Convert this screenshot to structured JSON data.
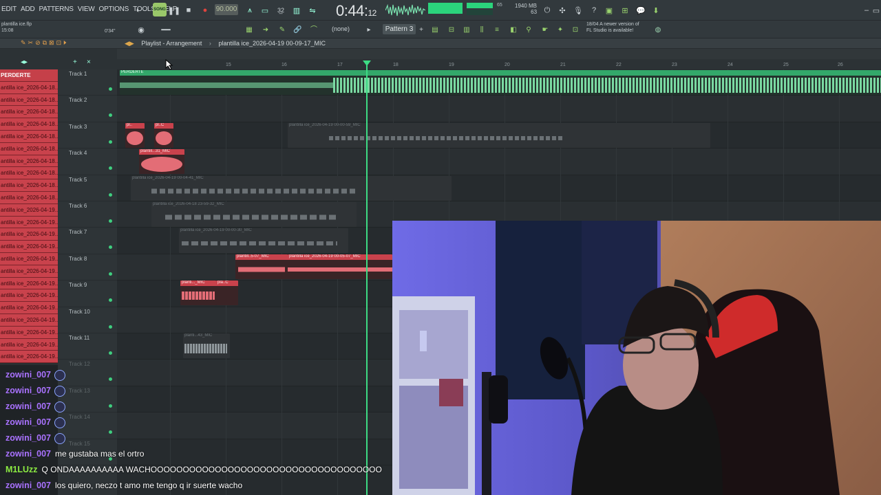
{
  "menu": [
    "EDIT",
    "ADD",
    "PATTERNS",
    "VIEW",
    "OPTIONS",
    "TOOLS",
    "HELP"
  ],
  "transport": {
    "song_mode": "SONG",
    "tempo": "90.000",
    "time_main": "0:44:",
    "time_sub": "12",
    "ram": "1940 MB",
    "ram_sub": "63",
    "cpu": "65"
  },
  "project": {
    "file": "plantilla ice.flp",
    "time_left": "15:08",
    "position": "0'34\""
  },
  "toolbar2": {
    "snap": "(none)",
    "pattern": "Pattern 3",
    "news_line1": "18/04  A newer version of",
    "news_line2": "FL Studio is available!"
  },
  "playlist": {
    "title": "Playlist - Arrangement",
    "breadcrumb": "plantilla ice_2026-04-19 00-09-17_MIC"
  },
  "ruler": [
    "15",
    "16",
    "17",
    "18",
    "19",
    "20",
    "21",
    "22",
    "23",
    "24",
    "25",
    "26"
  ],
  "cliplist": [
    "PERDERTE",
    "antilla ice_2026-04-18..",
    "antilla ice_2026-04-18..",
    "antilla ice_2026-04-18..",
    "antilla ice_2026-04-18..",
    "antilla ice_2026-04-18..",
    "antilla ice_2026-04-18..",
    "antilla ice_2026-04-18..",
    "antilla ice_2026-04-18..",
    "antilla ice_2026-04-18..",
    "antilla ice_2026-04-18..",
    "antilla ice_2026-04-19..",
    "antilla ice_2026-04-19..",
    "antilla ice_2026-04-19..",
    "antilla ice_2026-04-19..",
    "antilla ice_2026-04-19..",
    "antilla ice_2026-04-19..",
    "antilla ice_2026-04-19..",
    "antilla ice_2026-04-19..",
    "antilla ice_2026-04-19..",
    "antilla ice_2026-04-19..",
    "antilla ice_2026-04-19..",
    "antilla ice_2026-04-19..",
    "antilla ice_2026-04-19.."
  ],
  "tracks": [
    "Track 1",
    "Track 2",
    "Track 3",
    "Track 4",
    "Track 5",
    "Track 6",
    "Track 7",
    "Track 8",
    "Track 9",
    "Track 10",
    "Track 11",
    "Track 12",
    "Track 13",
    "Track 14",
    "Track 15"
  ],
  "clips": {
    "t1": "PERDERTE",
    "t3a": "pl..",
    "t3b": "pl..C",
    "t3c": "plantilla ice_2026-04-19 00-00-59_MIC",
    "t4": "plantill...31_MIC",
    "t5": "plantilla ice_2026-04-19 00-04-41_MIC",
    "t6": "plantilla ice_2026-04-18 23-59-32_MIC",
    "t7": "plantilla ice_2026-04-19 00-00-30_MIC",
    "t8a": "plantill..5-07_MIC",
    "t8b": "plantilla ice_2026-04-19 00-05-07_MIC",
    "t9a": "planti..._MIC",
    "t9b": "pla..C",
    "t11": "planti...43_MIC"
  },
  "chat": [
    {
      "user": "zowini_007",
      "text": "",
      "badge": true
    },
    {
      "user": "zowini_007",
      "text": "",
      "badge": true
    },
    {
      "user": "zowini_007",
      "text": "",
      "badge": true
    },
    {
      "user": "zowini_007",
      "text": "",
      "badge": true
    },
    {
      "user": "zowini_007",
      "text": "",
      "badge": true
    },
    {
      "user": "zowini_007",
      "text": "me gustaba mas el ortro",
      "badge": false
    },
    {
      "user": "M1LUzz",
      "text": "Q ONDAAAAAAAAAA WACHOOOOOOOOOOOOOOOOOOOOOOOOOOOOOOOOOOOO",
      "badge": false
    },
    {
      "user": "zowini_007",
      "text": "los quiero, neczo t amo me tengo q ir suerte wacho",
      "badge": false
    }
  ],
  "colors": {
    "accent": "#3ddc84",
    "clip_red": "#c9424c",
    "user_purple": "#a972ff",
    "user_green": "#8bea42"
  }
}
